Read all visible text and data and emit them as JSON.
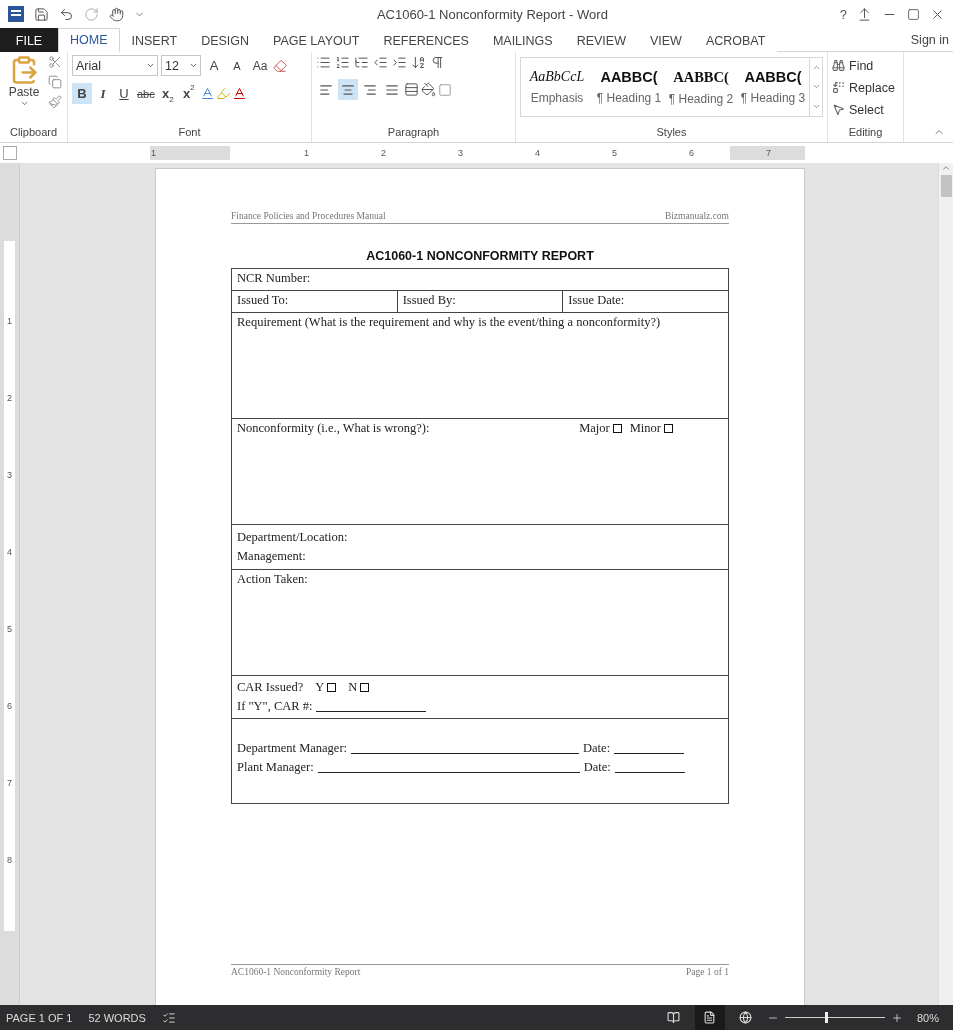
{
  "window": {
    "title": "AC1060-1 Nonconformity Report - Word",
    "help": "?"
  },
  "tabs": [
    {
      "label": "FILE",
      "kind": "file",
      "selected": false
    },
    {
      "label": "HOME",
      "kind": "tab",
      "selected": true
    },
    {
      "label": "INSERT",
      "kind": "tab",
      "selected": false
    },
    {
      "label": "DESIGN",
      "kind": "tab",
      "selected": false
    },
    {
      "label": "PAGE LAYOUT",
      "kind": "tab",
      "selected": false
    },
    {
      "label": "REFERENCES",
      "kind": "tab",
      "selected": false
    },
    {
      "label": "MAILINGS",
      "kind": "tab",
      "selected": false
    },
    {
      "label": "REVIEW",
      "kind": "tab",
      "selected": false
    },
    {
      "label": "VIEW",
      "kind": "tab",
      "selected": false
    },
    {
      "label": "ACROBAT",
      "kind": "tab",
      "selected": false
    }
  ],
  "sign_in": "Sign in",
  "ribbon": {
    "clipboard": {
      "paste": "Paste",
      "label": "Clipboard"
    },
    "font": {
      "font": "Arial",
      "size": "12",
      "label": "Font",
      "grow": "A",
      "shrink": "A",
      "case": "Aa",
      "buttons": [
        {
          "kind": "bold",
          "text": "B",
          "selected": true
        },
        {
          "kind": "italic",
          "text": "I",
          "selected": false
        },
        {
          "kind": "underline",
          "text": "U",
          "selected": false
        },
        {
          "kind": "strike",
          "text": "abc",
          "selected": false
        },
        {
          "kind": "sub",
          "text": "x",
          "mark": "2",
          "selected": false
        },
        {
          "kind": "sup",
          "text": "x",
          "mark": "2",
          "selected": false
        }
      ]
    },
    "paragraph": {
      "label": "Paragraph",
      "align": [
        {
          "kind": "left",
          "selected": false
        },
        {
          "kind": "center",
          "selected": true
        },
        {
          "kind": "right",
          "selected": false
        },
        {
          "kind": "justify",
          "selected": false
        }
      ]
    },
    "styles": {
      "label": "Styles",
      "items": [
        {
          "kind": "emphasis",
          "sample": "AaBbCcL",
          "name": "Emphasis"
        },
        {
          "kind": "heading1",
          "sample": "AABBC(",
          "name": "¶ Heading 1"
        },
        {
          "kind": "heading2",
          "sample": "AABBC(",
          "name": "¶ Heading 2"
        },
        {
          "kind": "heading3",
          "sample": "AABBC(",
          "name": "¶ Heading 3"
        }
      ]
    },
    "editing": {
      "label": "Editing",
      "items": [
        {
          "kind": "find",
          "text": "Find"
        },
        {
          "kind": "replace",
          "text": "Replace"
        },
        {
          "kind": "select",
          "text": "Select"
        }
      ]
    }
  },
  "ruler": {
    "horizontal": [
      "1",
      "1",
      "2",
      "3",
      "4",
      "5",
      "6",
      "7"
    ],
    "vertical": [
      "1",
      "2",
      "3",
      "4",
      "5",
      "6",
      "7",
      "8"
    ]
  },
  "document": {
    "header_left": "Finance Policies and Procedures Manual",
    "header_right": "Bizmanualz.com",
    "title": "AC1060-1 NONCONFORMITY REPORT",
    "rows": [
      {
        "kind": "single",
        "text": "NCR Number:"
      },
      {
        "kind": "three",
        "cells": [
          "Issued To:",
          "Issued By:",
          "Issue Date:"
        ]
      },
      {
        "kind": "tall",
        "text": "Requirement (What is the requirement and why is the event/thing a nonconformity?)"
      },
      {
        "kind": "tall",
        "text": "Nonconformity (i.e., What is wrong?):",
        "checks": [
          {
            "label": "Major",
            "checked": false
          },
          {
            "label": "Minor",
            "checked": false
          }
        ]
      },
      {
        "kind": "lines",
        "lines": [
          "Department/Location:",
          "Management:"
        ]
      },
      {
        "kind": "tall",
        "text": "Action Taken:"
      },
      {
        "kind": "car",
        "text": "CAR Issued?",
        "checks": [
          {
            "label": "Y",
            "checked": false
          },
          {
            "label": "N",
            "checked": false
          }
        ],
        "line": "If \"Y\", CAR #:"
      },
      {
        "kind": "signatures",
        "signatures": [
          {
            "label": "Department Manager:",
            "date": "Date:"
          },
          {
            "label": "Plant Manager:",
            "date": "Date:"
          }
        ]
      }
    ],
    "footer_left": "AC1060-1 Nonconformity Report",
    "footer_right": "Page 1 of 1"
  },
  "status_bar": {
    "page": "PAGE 1 OF 1",
    "words": "52 WORDS",
    "views": [
      {
        "kind": "read",
        "selected": false
      },
      {
        "kind": "print",
        "selected": true
      },
      {
        "kind": "web",
        "selected": false
      }
    ],
    "zoom": {
      "level": 0.4,
      "text": "80%"
    }
  }
}
